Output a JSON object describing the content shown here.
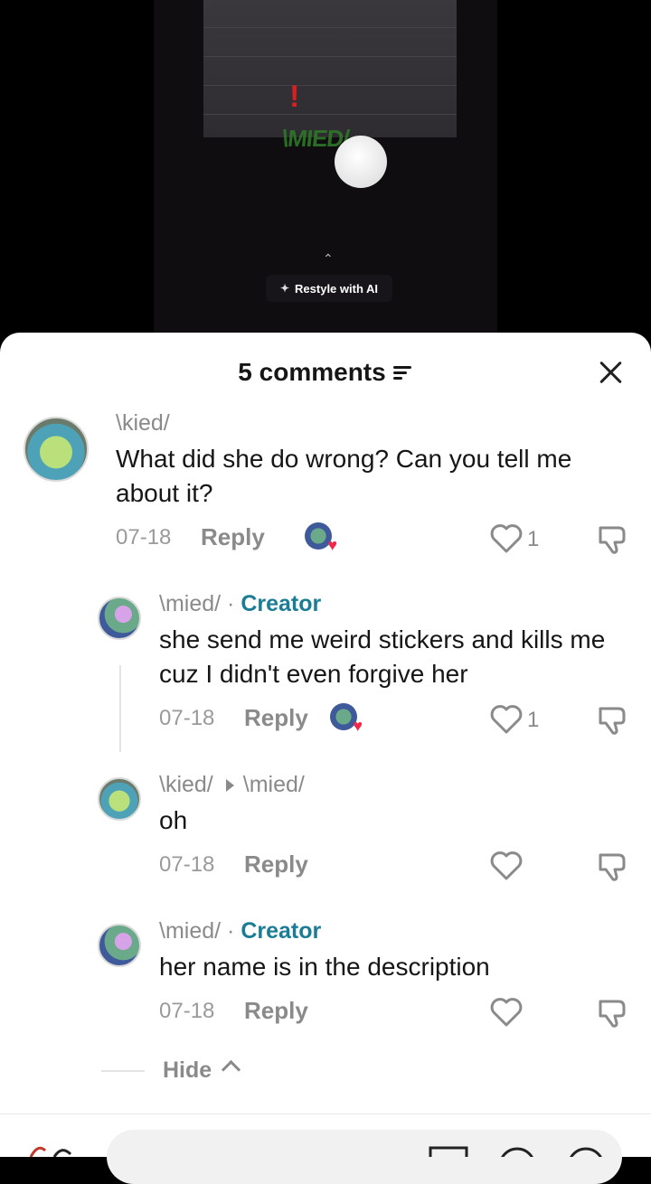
{
  "video": {
    "overlay_mark": "!",
    "overlay_text": "\\MIED/",
    "restyle_label": "Restyle with AI"
  },
  "sheet": {
    "title": "5 comments",
    "comments": [
      {
        "user": "\\kied/",
        "text": "What did she do wrong? Can you tell me about it?",
        "date": "07-18",
        "reply_label": "Reply",
        "likes": "1",
        "creator_liked": true
      },
      {
        "user": "\\mied/",
        "separator": " · ",
        "badge": "Creator",
        "text": "she send me weird stickers and kills me cuz I didn't even forgive her",
        "date": "07-18",
        "reply_label": "Reply",
        "likes": "1",
        "creator_liked": true
      },
      {
        "user": "\\kied/",
        "reply_to": "\\mied/",
        "text": "oh",
        "date": "07-18",
        "reply_label": "Reply",
        "likes": ""
      },
      {
        "user": "\\mied/",
        "separator": " · ",
        "badge": "Creator",
        "text": "her name is in the description",
        "date": "07-18",
        "reply_label": "Reply",
        "likes": ""
      }
    ],
    "hide_label": "Hide"
  },
  "colors": {
    "creator": "#1b7d95",
    "like_heart": "#f0284a"
  }
}
